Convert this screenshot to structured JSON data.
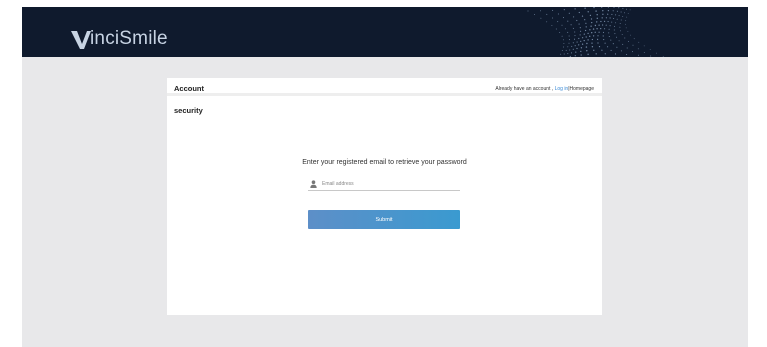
{
  "brand": {
    "name": "VinciSmile",
    "logo_text": "inciSmile",
    "colors": {
      "header_bg": "#0f1a2d",
      "logo": "#c7d3e3",
      "accent": "#3a8ad6",
      "button": "#4a92cc"
    }
  },
  "account": {
    "title": "Account",
    "subtitle": "security"
  },
  "header_links": {
    "prefix": "Already have an account ,",
    "login": "Log in",
    "separator": "|",
    "homepage": "Homepage"
  },
  "form": {
    "prompt": "Enter your registered email to retrieve your password",
    "email_placeholder": "Email address",
    "email_value": "",
    "submit_label": "Submit",
    "icons": {
      "email": "user-icon"
    }
  }
}
